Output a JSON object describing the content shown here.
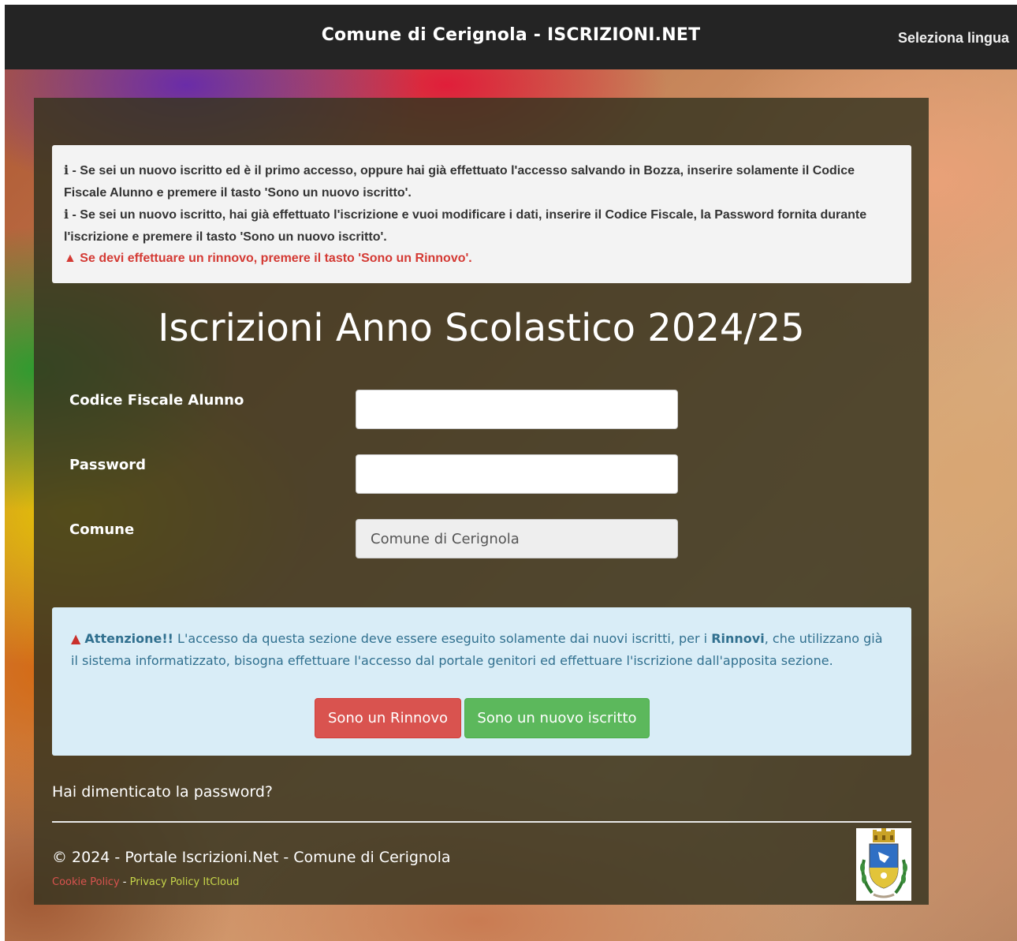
{
  "navbar": {
    "brand": "Comune di Cerignola - ISCRIZIONI.NET",
    "language_label": "Seleziona lingua"
  },
  "info_box": {
    "line1_icon": "i",
    "line1": " - Se sei un nuovo iscritto ed è il primo accesso, oppure hai già effettuato l'accesso salvando in Bozza, inserire solamente il Codice Fiscale Alunno e premere il tasto 'Sono un nuovo iscritto'.",
    "line2_icon": "i",
    "line2": " - Se sei un nuovo iscritto, hai già effettuato l'iscrizione e vuoi modificare i dati, inserire il Codice Fiscale, la Password fornita durante l'iscrizione e premere il tasto 'Sono un nuovo iscritto'.",
    "warning": "Se devi effettuare un rinnovo, premere il tasto 'Sono un Rinnovo'."
  },
  "title": "Iscrizioni Anno Scolastico 2024/25",
  "form": {
    "codice_label": "Codice Fiscale Alunno",
    "codice_value": "",
    "password_label": "Password",
    "password_value": "",
    "comune_label": "Comune",
    "comune_value": "Comune di Cerignola"
  },
  "alert": {
    "strong": "Attenzione!!",
    "text1": " L'accesso da questa sezione deve essere eseguito solamente dai nuovi iscritti, per i ",
    "rinnovi": "Rinnovi",
    "text2": ", che utilizzano già il sistema informatizzato, bisogna effettuare l'accesso dal portale genitori ed effettuare l'iscrizione dall'apposita sezione."
  },
  "buttons": {
    "rinnovo": "Sono un Rinnovo",
    "nuovo": "Sono un nuovo iscritto"
  },
  "forgot_password": "Hai dimenticato la password?",
  "footer": {
    "copyright": "© 2024 - Portale Iscrizioni.Net - Comune di Cerignola",
    "cookie": "Cookie Policy",
    "separator": "-",
    "privacy": "Privacy Policy ItCloud"
  },
  "colors": {
    "navbar": "#242424",
    "danger": "#d9534f",
    "success": "#5cb85c",
    "alert_bg": "#d9edf7",
    "alert_text": "#31708f"
  },
  "icons": {
    "warning": "warning-triangle-icon",
    "info": "info-icon",
    "crest": "city-crest-icon"
  }
}
